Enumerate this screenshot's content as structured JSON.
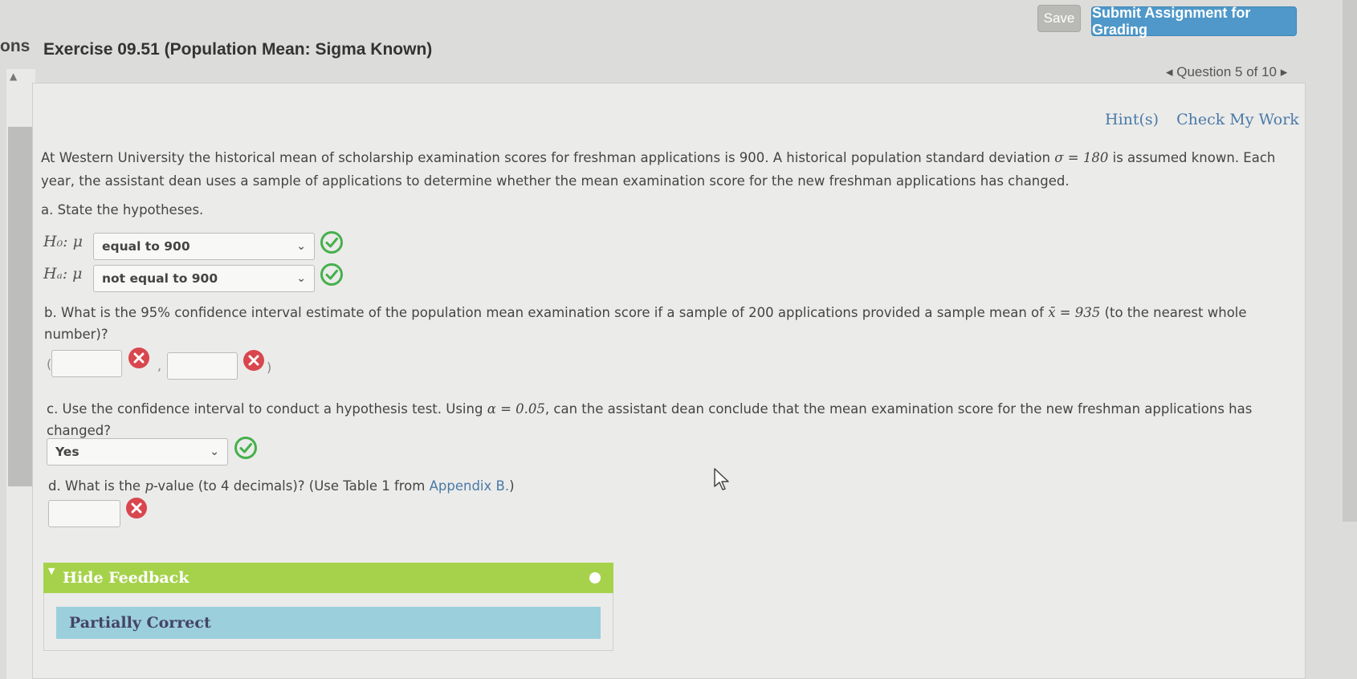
{
  "toolbar": {
    "save_label": "Save",
    "submit_label": "Submit Assignment for Grading"
  },
  "sidebar": {
    "cut_label": "ons"
  },
  "header": {
    "title": "Exercise 09.51 (Population Mean: Sigma Known)",
    "question_nav": "◂ Question 5 of 10 ▸"
  },
  "links": {
    "hints": "Hint(s)",
    "check_work": "Check My Work"
  },
  "problem": {
    "intro_1": "At Western University the historical mean of scholarship examination scores for freshman applications is 900. A historical population standard deviation",
    "sigma_eq": "σ = 180",
    "intro_2": "is assumed known. Each year, the assistant dean uses a sample of applications to determine whether the mean examination score for the new freshman applications has changed."
  },
  "part_a": {
    "prompt": "a. State the hypotheses.",
    "h0_label": "H₀: μ",
    "h0_value": "equal to 900",
    "ha_label": "Hₐ: μ",
    "ha_value": "not equal to 900"
  },
  "part_b": {
    "prompt_1": "b. What is the 95% confidence interval estimate of the population mean examination score if a sample of 200 applications provided a sample mean of",
    "xbar_eq": "x̄ = 935",
    "prompt_2": "(to the nearest whole number)?",
    "open_paren": "(",
    "comma": ",",
    "close_paren": ")",
    "lower_value": "",
    "upper_value": ""
  },
  "part_c": {
    "prompt_1": "c. Use the confidence interval to conduct a hypothesis test. Using",
    "alpha_eq": "α = 0.05",
    "prompt_2": ", can the assistant dean conclude that the mean examination score for the new freshman applications has changed?",
    "answer": "Yes"
  },
  "part_d": {
    "prompt_1": "d. What is the",
    "p_symbol": "p",
    "prompt_2": "-value (to 4 decimals)? (Use Table 1 from",
    "appendix_link": "Appendix B.",
    "prompt_3": ")",
    "value": ""
  },
  "feedback": {
    "toggle_label": "Hide Feedback",
    "status": "Partially Correct"
  },
  "colors": {
    "correct": "#45b04b",
    "incorrect": "#d9464d",
    "feedback_header": "#a6d24b",
    "feedback_status": "#9bcfdc",
    "link": "#4b7aa6"
  }
}
